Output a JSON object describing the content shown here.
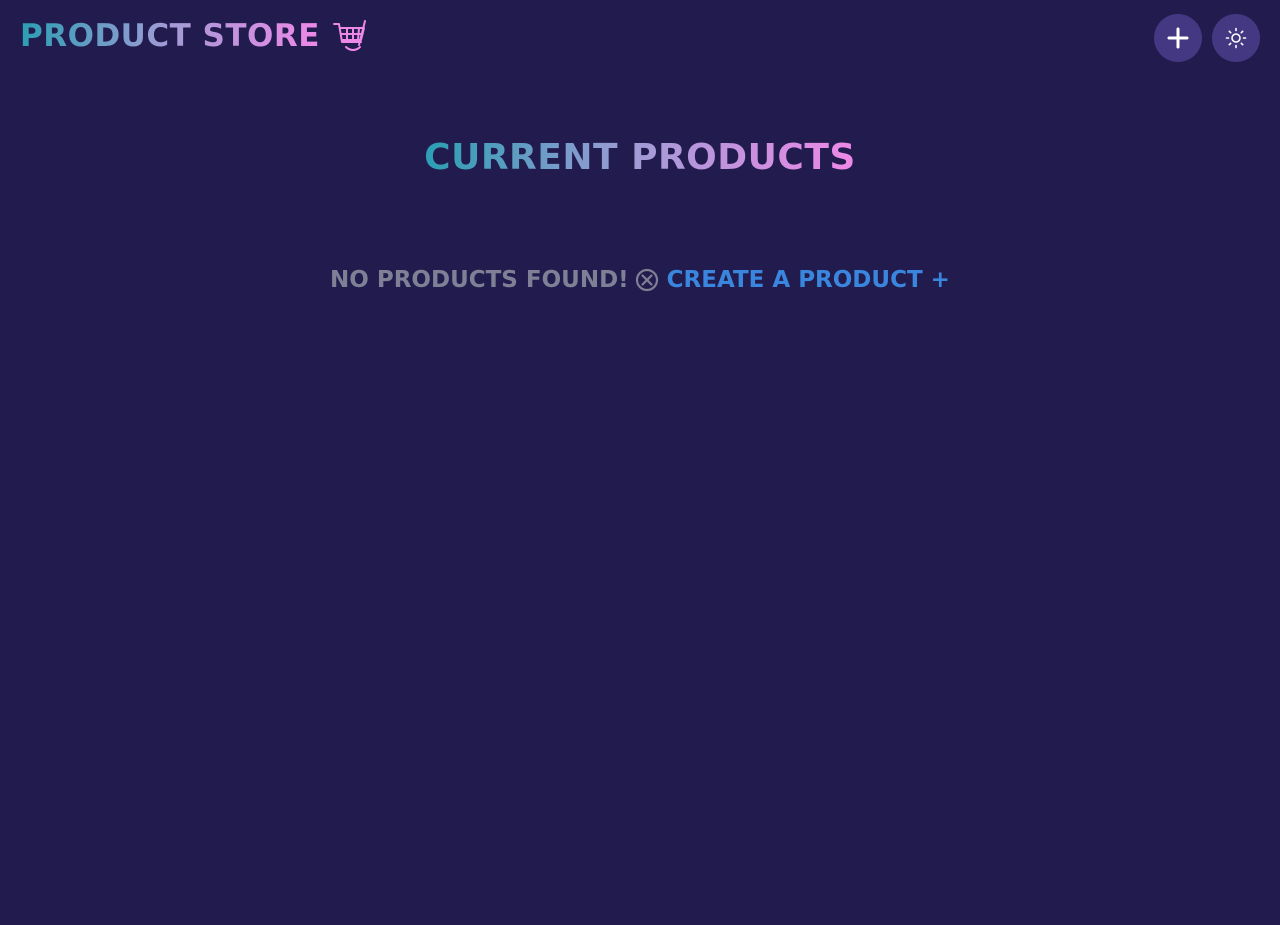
{
  "navbar": {
    "brand_label": "PRODUCT STORE",
    "brand_icon": "shopping-cart-icon",
    "create_button_icon": "plus-icon",
    "theme_button_icon": "sun-icon"
  },
  "main": {
    "title": "CURRENT PRODUCTS",
    "empty_message": "NO PRODUCTS FOUND!",
    "empty_icon": "x-circle-icon",
    "create_link_label": "CREATE A PRODUCT +"
  },
  "colors": {
    "background": "#221c4e",
    "gradient_start": "#2b9fb3",
    "gradient_end": "#ee88e7",
    "button_bg": "#453882",
    "muted_text": "#7f7f95",
    "link": "#3a85dd"
  }
}
